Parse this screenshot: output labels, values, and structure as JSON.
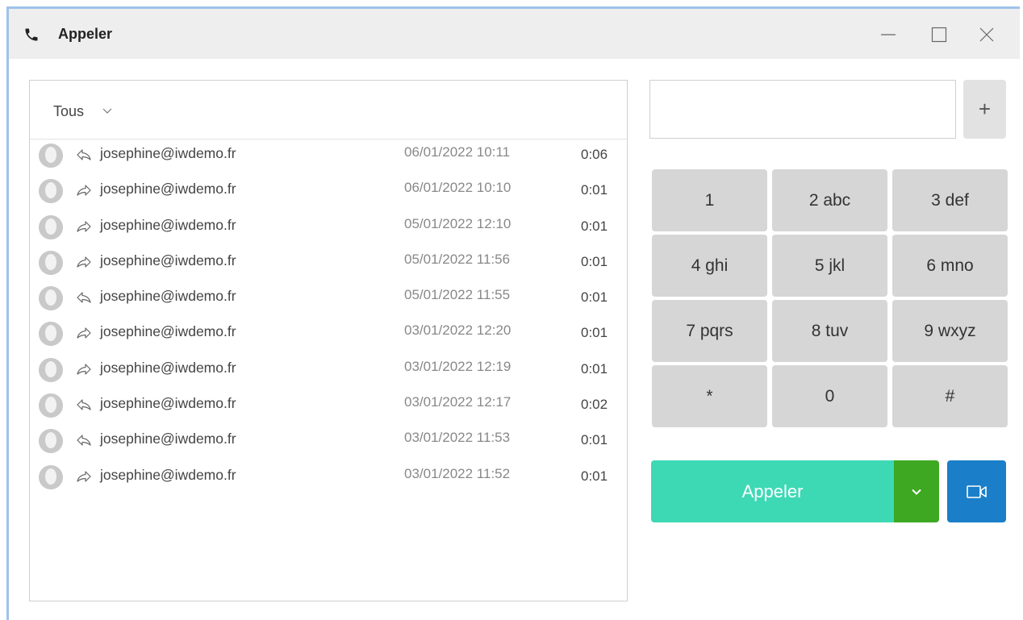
{
  "window": {
    "title": "Appeler",
    "title_icon": "phone-icon",
    "controls": [
      "minimize-icon",
      "maximize-icon",
      "close-icon"
    ]
  },
  "history": {
    "filter_label": "Tous",
    "rows": [
      {
        "direction": "incoming",
        "email": "josephine@iwdemo.fr",
        "date": "06/01/2022 10:11",
        "duration": "0:06"
      },
      {
        "direction": "outgoing",
        "email": "josephine@iwdemo.fr",
        "date": "06/01/2022 10:10",
        "duration": "0:01"
      },
      {
        "direction": "outgoing",
        "email": "josephine@iwdemo.fr",
        "date": "05/01/2022 12:10",
        "duration": "0:01"
      },
      {
        "direction": "outgoing",
        "email": "josephine@iwdemo.fr",
        "date": "05/01/2022 11:56",
        "duration": "0:01"
      },
      {
        "direction": "incoming",
        "email": "josephine@iwdemo.fr",
        "date": "05/01/2022 11:55",
        "duration": "0:01"
      },
      {
        "direction": "outgoing",
        "email": "josephine@iwdemo.fr",
        "date": "03/01/2022 12:20",
        "duration": "0:01"
      },
      {
        "direction": "outgoing",
        "email": "josephine@iwdemo.fr",
        "date": "03/01/2022 12:19",
        "duration": "0:01"
      },
      {
        "direction": "incoming",
        "email": "josephine@iwdemo.fr",
        "date": "03/01/2022 12:17",
        "duration": "0:02"
      },
      {
        "direction": "incoming",
        "email": "josephine@iwdemo.fr",
        "date": "03/01/2022 11:53",
        "duration": "0:01"
      },
      {
        "direction": "outgoing",
        "email": "josephine@iwdemo.fr",
        "date": "03/01/2022 11:52",
        "duration": "0:01"
      }
    ]
  },
  "dialer": {
    "input_value": "",
    "add_label": "+",
    "keys": [
      "1",
      "2 abc",
      "3 def",
      "4 ghi",
      "5 jkl",
      "6 mno",
      "7 pqrs",
      "8 tuv",
      "9 wxyz",
      "*",
      "0",
      "#"
    ],
    "call_label": "Appeler",
    "colors": {
      "call": "#3dd9b4",
      "dropdown": "#3ea823",
      "video": "#1a7fc8",
      "key": "#d6d6d6"
    }
  }
}
